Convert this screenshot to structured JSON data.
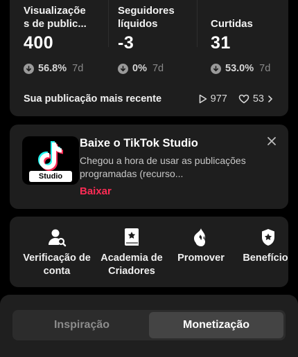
{
  "stats": {
    "items": [
      {
        "label_line1": "Visualizaçõe",
        "label_line2": "s de public...",
        "value": "400",
        "delta": "56.8%",
        "period": "7d"
      },
      {
        "label_line1": "Seguidores",
        "label_line2": "líquidos",
        "value": "-3",
        "delta": "0%",
        "period": "7d"
      },
      {
        "label_line1": "",
        "label_line2": "Curtidas",
        "value": "31",
        "delta": "53.0%",
        "period": "7d"
      }
    ],
    "recent_label": "Sua publicação mais recente",
    "recent_views": "977",
    "recent_likes": "53"
  },
  "promo": {
    "icon_label": "Studio",
    "title": "Baixe o TikTok Studio",
    "description": "Chegou a hora de usar as publicações programadas (recurso...",
    "cta": "Baixar"
  },
  "tools": [
    {
      "label": "Verificação de conta",
      "icon": "user-search-icon"
    },
    {
      "label": "Academia de Criadores",
      "icon": "book-star-icon"
    },
    {
      "label": "Promover",
      "icon": "flame-icon"
    },
    {
      "label": "Benefícios",
      "icon": "badge-star-icon"
    }
  ],
  "tabs": [
    {
      "label": "Inspiração",
      "active": false
    },
    {
      "label": "Monetização",
      "active": true
    }
  ],
  "colors": {
    "accent": "#fe2c55",
    "card": "#1e1e1e",
    "background": "#000000"
  }
}
